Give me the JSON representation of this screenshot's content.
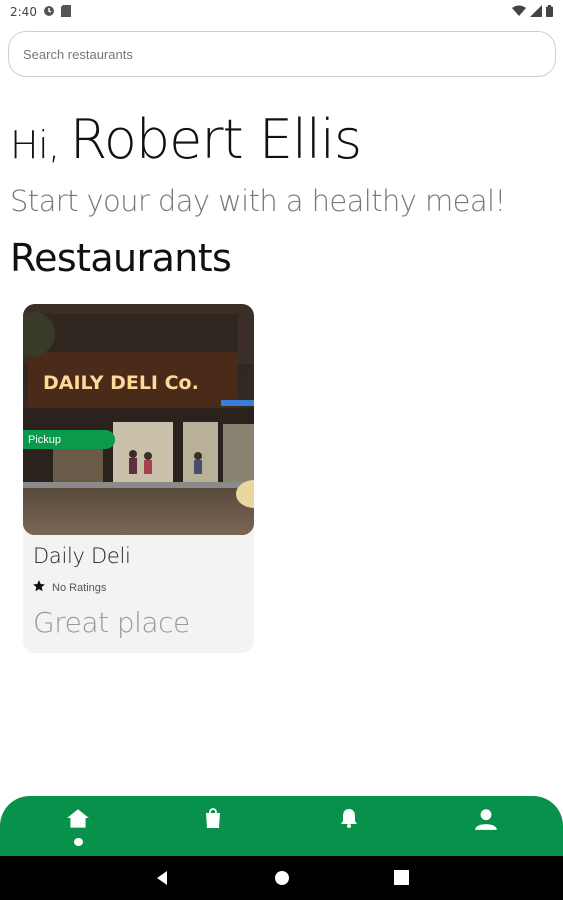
{
  "status_bar": {
    "time": "2:40"
  },
  "search": {
    "placeholder": "Search restaurants",
    "value": ""
  },
  "greeting": {
    "hi": "Hi,",
    "name": "Robert Ellis"
  },
  "subtitle": "Start your day with a healthy meal!",
  "section_title": "Restaurants",
  "restaurants": [
    {
      "name": "Daily Deli",
      "sign_text": "DAILY DELI Co.",
      "badge": "Pickup",
      "rating_text": "No Ratings",
      "description": "Great place"
    }
  ],
  "bottom_nav": {
    "items": [
      {
        "icon": "home-icon",
        "active": true
      },
      {
        "icon": "shopping-bag-icon",
        "active": false
      },
      {
        "icon": "bell-icon",
        "active": false
      },
      {
        "icon": "user-icon",
        "active": false
      }
    ]
  },
  "colors": {
    "accent": "#08914a",
    "badge": "#0a9a4b"
  }
}
